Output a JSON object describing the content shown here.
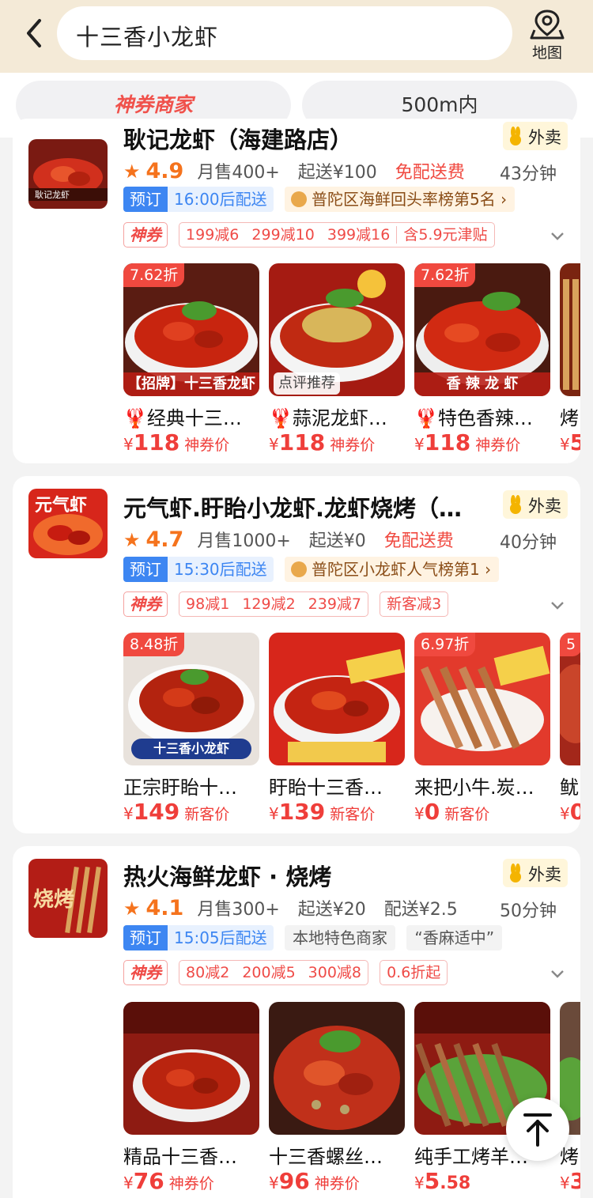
{
  "header": {
    "search_text": "十三香小龙虾",
    "map_label": "地图"
  },
  "filters": {
    "chip_a": "神券商家",
    "chip_b": "500m内"
  },
  "colors": {
    "accent": "#f0514b",
    "price": "#ef3e3a",
    "rating": "#f5731d",
    "preorder_blue": "#3d86f2",
    "header_bg": "#f4ead7"
  },
  "shops": [
    {
      "name": "耿记龙虾（海建路店）",
      "takeaway": "外卖",
      "star": "★",
      "rating": "4.9",
      "monthly_sales": "月售400+",
      "min_order": "起送¥100",
      "delivery_fee": "免配送费",
      "delivery_time": "43分钟",
      "preorder": "预订",
      "preorder_time": "16:00后配送",
      "rank": "普陀区海鲜回头率榜第5名 ›",
      "coupon_tag": "神券",
      "coupons": [
        "199减6",
        "299减10",
        "399减16",
        "含5.9元津贴"
      ],
      "logo_text": "耿记龙虾",
      "dishes": [
        {
          "discount": "7.62折",
          "caption": "【招牌】十三香龙虾",
          "name": "🦞经典十三…",
          "yen": "¥",
          "price": "118",
          "label": "神券价"
        },
        {
          "discount": "",
          "caption": "点评推荐",
          "name": "🦞蒜泥龙虾…",
          "yen": "¥",
          "price": "118",
          "label": "神券价"
        },
        {
          "discount": "7.62折",
          "caption": "香 辣 龙 虾",
          "name": "🦞特色香辣…",
          "yen": "¥",
          "price": "118",
          "label": "神券价"
        },
        {
          "discount": "",
          "caption": "",
          "name": "烤",
          "yen": "¥",
          "price": "5",
          "label": ""
        }
      ]
    },
    {
      "name": "元气虾.盱眙小龙虾.龙虾烧烤（…",
      "takeaway": "外卖",
      "star": "★",
      "rating": "4.7",
      "monthly_sales": "月售1000+",
      "min_order": "起送¥0",
      "delivery_fee": "免配送费",
      "delivery_time": "40分钟",
      "preorder": "预订",
      "preorder_time": "15:30后配送",
      "rank": "普陀区小龙虾人气榜第1 ›",
      "coupon_tag": "神券",
      "coupons": [
        "98减1",
        "129减2",
        "239减7"
      ],
      "extra_coupon": "新客减3",
      "logo_text": "元气虾",
      "dishes": [
        {
          "discount": "8.48折",
          "caption": "十三香小龙虾",
          "name": "正宗盱眙十…",
          "yen": "¥",
          "price": "149",
          "label": "新客价"
        },
        {
          "discount": "",
          "caption": "",
          "name": "盱眙十三香…",
          "yen": "¥",
          "price": "139",
          "label": "新客价"
        },
        {
          "discount": "6.97折",
          "caption": "",
          "name": "来把小牛.炭…",
          "yen": "¥",
          "price": "0",
          "label": "新客价"
        },
        {
          "discount": "5",
          "caption": "",
          "name": "鱿",
          "yen": "¥",
          "price": "0",
          "label": ""
        }
      ]
    },
    {
      "name": "热火海鲜龙虾 · 烧烤",
      "takeaway": "外卖",
      "star": "★",
      "rating": "4.1",
      "monthly_sales": "月售300+",
      "min_order": "起送¥20",
      "delivery_fee": "配送¥2.5",
      "delivery_time": "50分钟",
      "preorder": "预订",
      "preorder_time": "15:05后配送",
      "tag_a": "本地特色商家",
      "tag_b": "“香麻适中”",
      "coupon_tag": "神券",
      "coupons": [
        "80减2",
        "200减5",
        "300减8"
      ],
      "extra_coupon": "0.6折起",
      "logo_text": "烧烤",
      "dishes": [
        {
          "discount": "",
          "caption": "",
          "name": "精品十三香…",
          "yen": "¥",
          "price": "76",
          "label": "神券价"
        },
        {
          "discount": "",
          "caption": "",
          "name": "十三香螺丝…",
          "yen": "¥",
          "price": "96",
          "label": "神券价"
        },
        {
          "discount": "",
          "caption": "",
          "name": "纯手工烤羊…",
          "yen": "¥",
          "price": "5",
          "price_dec": ".58",
          "label": ""
        },
        {
          "discount": "",
          "caption": "",
          "name": "烤",
          "yen": "¥",
          "price": "3",
          "label": ""
        }
      ]
    }
  ]
}
